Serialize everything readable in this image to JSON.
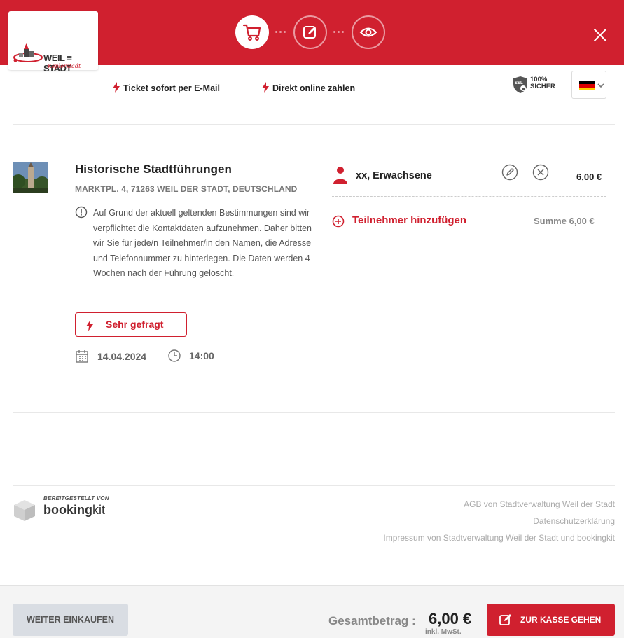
{
  "brand": {
    "logo_name": "WEIL DER STADT",
    "logo_name_display": "WEIL ≡ STADT",
    "logo_tagline": "Keplerstadt",
    "accent_color": "#d0202f"
  },
  "header": {
    "steps": [
      {
        "name": "cart",
        "icon": "cart-icon",
        "active": true
      },
      {
        "name": "edit",
        "icon": "edit-icon",
        "active": false
      },
      {
        "name": "preview",
        "icon": "eye-icon",
        "active": false
      }
    ],
    "close_icon": "close-icon"
  },
  "trust_bar": {
    "item_1": "Ticket sofort per E-Mail",
    "item_2": "Direkt online zahlen",
    "ssl_line_1": "100%",
    "ssl_line_2": "SICHER",
    "ssl_badge": "SSL",
    "language": "de"
  },
  "product": {
    "title": "Historische Stadtführungen",
    "address": "MARKTPL. 4, 71263 WEIL DER STADT, DEUTSCHLAND",
    "notice": "Auf Grund der aktuell geltenden Bestimmungen sind wir verpflichtet die Kontaktdaten aufzunehmen. Daher bitten wir Sie für jede/n Teilnehmer/in den Namen, die Adresse und Telefonnummer zu hinterlegen. Die Daten werden 4 Wochen nach der Führung gelöscht.",
    "badge": "Sehr gefragt",
    "date": "14.04.2024",
    "time": "14:00"
  },
  "participants": {
    "items": [
      {
        "name": "xx, Erwachsene",
        "price": "6,00 €"
      }
    ],
    "add_label": "Teilnehmer hinzufügen",
    "sum_label": "Summe",
    "sum_value": "6,00 €"
  },
  "footer": {
    "provided_by": "BEREITGESTELLT VON",
    "bk_bold": "booking",
    "bk_light": "kit",
    "links": [
      "AGB von Stadtverwaltung Weil der Stadt",
      "Datenschutzerklärung",
      "Impressum von Stadtverwaltung Weil der Stadt und bookingkit"
    ]
  },
  "bottom_bar": {
    "continue_label": "WEITER EINKAUFEN",
    "total_label": "Gesamtbetrag :",
    "total_value": "6,00 €",
    "vat_label": "inkl. MwSt.",
    "checkout_label": "ZUR KASSE GEHEN"
  }
}
